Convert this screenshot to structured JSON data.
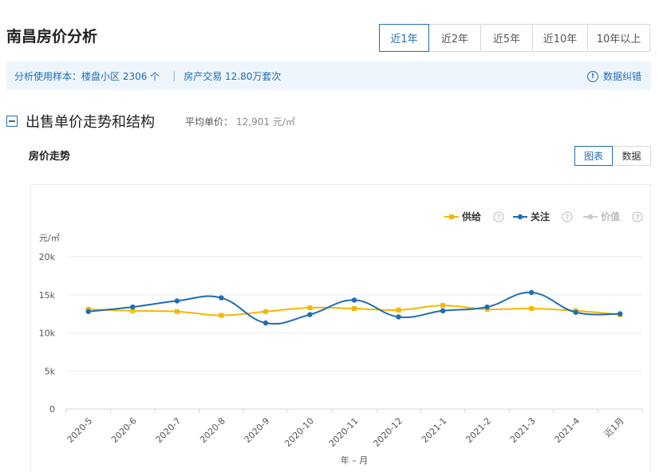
{
  "header": {
    "title": "南昌房价分析"
  },
  "range_tabs": [
    {
      "label": "近1年",
      "active": true
    },
    {
      "label": "近2年",
      "active": false
    },
    {
      "label": "近5年",
      "active": false
    },
    {
      "label": "近10年",
      "active": false
    },
    {
      "label": "10年以上",
      "active": false
    }
  ],
  "info_bar": {
    "sample_label": "分析使用样本：",
    "sample_value": "楼盘小区 2306 个",
    "trade_value": "房产交易 12.80万套次",
    "correction": "数据纠错"
  },
  "section": {
    "title": "出售单价走势和结构",
    "avg_label": "平均单价：",
    "avg_value": "12,901 元/㎡"
  },
  "trend": {
    "title": "房价走势",
    "view_chart": "图表",
    "view_data": "数据"
  },
  "colors": {
    "supply": "#f5b800",
    "attention": "#1f6db5",
    "price": "#cccccc",
    "accent": "#1f6db5"
  },
  "chart_data": {
    "type": "line",
    "ylabel": "元/㎡",
    "xlabel": "年 – 月",
    "ylim": [
      0,
      20000
    ],
    "yticks": [
      "0",
      "5k",
      "10k",
      "15k",
      "20k"
    ],
    "categories": [
      "2020-5",
      "2020-6",
      "2020-7",
      "2020-8",
      "2020-9",
      "2020-10",
      "2020-11",
      "2020-12",
      "2021-1",
      "2021-2",
      "2021-3",
      "2021-4",
      "近1月"
    ],
    "legend_position": "top-right",
    "series": [
      {
        "name": "供给",
        "values": [
          13100,
          12900,
          12800,
          12300,
          12800,
          13300,
          13200,
          13000,
          13600,
          13100,
          13200,
          12900,
          12400
        ],
        "visible": true
      },
      {
        "name": "关注",
        "values": [
          12800,
          13400,
          14200,
          14600,
          11300,
          12400,
          14300,
          12100,
          12900,
          13400,
          15300,
          12700,
          12500
        ],
        "visible": true
      },
      {
        "name": "价值",
        "values": [],
        "visible": false
      }
    ]
  }
}
